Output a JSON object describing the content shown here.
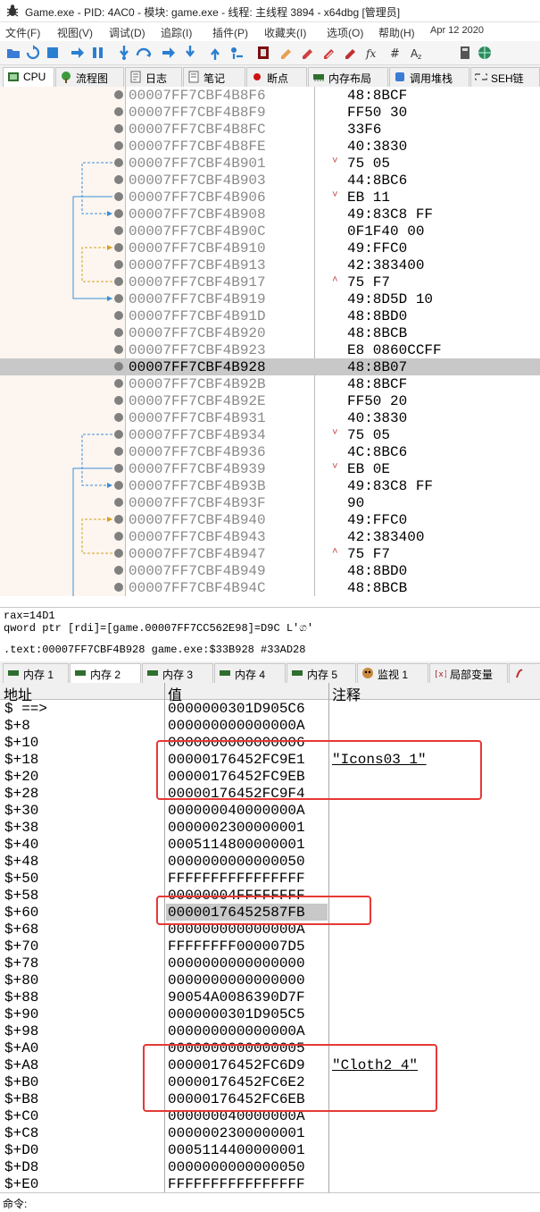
{
  "window": {
    "title": "Game.exe - PID: 4AC0 - 模块: game.exe - 线程: 主线程 3894 - x64dbg [管理员]"
  },
  "menu": {
    "items": [
      "文件(F)",
      "视图(V)",
      "调试(D)",
      "追踪(I)",
      "插件(P)",
      "收藏夹(I)",
      "选项(O)",
      "帮助(H)"
    ],
    "date": "Apr 12 2020"
  },
  "toolbar": {
    "icons": [
      "open-icon",
      "restart-icon",
      "stop-icon",
      "run-icon",
      "pause-icon",
      "step-into-icon",
      "step-over-icon",
      "trace-into-icon",
      "trace-over-icon",
      "execute-till-return-icon",
      "run-to-user-code-icon",
      "patch-icon",
      "comment-icon",
      "label-icon",
      "bookmark-icon",
      "function-icon",
      "fx-icon",
      "hash-icon",
      "font-icon",
      "calculator-icon",
      "globe-icon"
    ]
  },
  "cpu_tabs": [
    {
      "label": "CPU",
      "icon": "cpu-icon",
      "active": true
    },
    {
      "label": "流程图",
      "icon": "graph-icon"
    },
    {
      "label": "日志",
      "icon": "log-icon"
    },
    {
      "label": "笔记",
      "icon": "notes-icon"
    },
    {
      "label": "断点",
      "icon": "breakpoint-icon"
    },
    {
      "label": "内存布局",
      "icon": "memory-map-icon"
    },
    {
      "label": "调用堆栈",
      "icon": "call-stack-icon"
    },
    {
      "label": "SEH链",
      "icon": "seh-icon"
    }
  ],
  "disasm": {
    "selected_index": 16,
    "rows": [
      {
        "addr": "00007FF7CBF4B8F6",
        "bytes": "48:8BCF",
        "arrow": ""
      },
      {
        "addr": "00007FF7CBF4B8F9",
        "bytes": "FF50 30",
        "arrow": ""
      },
      {
        "addr": "00007FF7CBF4B8FC",
        "bytes": "33F6",
        "arrow": ""
      },
      {
        "addr": "00007FF7CBF4B8FE",
        "bytes": "40:3830",
        "arrow": ""
      },
      {
        "addr": "00007FF7CBF4B901",
        "bytes": "75 05",
        "arrow": "v"
      },
      {
        "addr": "00007FF7CBF4B903",
        "bytes": "44:8BC6",
        "arrow": ""
      },
      {
        "addr": "00007FF7CBF4B906",
        "bytes": "EB 11",
        "arrow": "v"
      },
      {
        "addr": "00007FF7CBF4B908",
        "bytes": "49:83C8 FF",
        "arrow": ""
      },
      {
        "addr": "00007FF7CBF4B90C",
        "bytes": "0F1F40 00",
        "arrow": ""
      },
      {
        "addr": "00007FF7CBF4B910",
        "bytes": "49:FFC0",
        "arrow": ""
      },
      {
        "addr": "00007FF7CBF4B913",
        "bytes": "42:383400",
        "arrow": ""
      },
      {
        "addr": "00007FF7CBF4B917",
        "bytes": "75 F7",
        "arrow": "^"
      },
      {
        "addr": "00007FF7CBF4B919",
        "bytes": "49:8D5D 10",
        "arrow": ""
      },
      {
        "addr": "00007FF7CBF4B91D",
        "bytes": "48:8BD0",
        "arrow": ""
      },
      {
        "addr": "00007FF7CBF4B920",
        "bytes": "48:8BCB",
        "arrow": ""
      },
      {
        "addr": "00007FF7CBF4B923",
        "bytes": "E8 0860CCFF",
        "arrow": ""
      },
      {
        "addr": "00007FF7CBF4B928",
        "bytes": "48:8B07",
        "arrow": ""
      },
      {
        "addr": "00007FF7CBF4B92B",
        "bytes": "48:8BCF",
        "arrow": ""
      },
      {
        "addr": "00007FF7CBF4B92E",
        "bytes": "FF50 20",
        "arrow": ""
      },
      {
        "addr": "00007FF7CBF4B931",
        "bytes": "40:3830",
        "arrow": ""
      },
      {
        "addr": "00007FF7CBF4B934",
        "bytes": "75 05",
        "arrow": "v"
      },
      {
        "addr": "00007FF7CBF4B936",
        "bytes": "4C:8BC6",
        "arrow": ""
      },
      {
        "addr": "00007FF7CBF4B939",
        "bytes": "EB 0E",
        "arrow": "v"
      },
      {
        "addr": "00007FF7CBF4B93B",
        "bytes": "49:83C8 FF",
        "arrow": ""
      },
      {
        "addr": "00007FF7CBF4B93F",
        "bytes": "90",
        "arrow": ""
      },
      {
        "addr": "00007FF7CBF4B940",
        "bytes": "49:FFC0",
        "arrow": ""
      },
      {
        "addr": "00007FF7CBF4B943",
        "bytes": "42:383400",
        "arrow": ""
      },
      {
        "addr": "00007FF7CBF4B947",
        "bytes": "75 F7",
        "arrow": "^"
      },
      {
        "addr": "00007FF7CBF4B949",
        "bytes": "48:8BD0",
        "arrow": ""
      },
      {
        "addr": "00007FF7CBF4B94C",
        "bytes": "48:8BCB",
        "arrow": ""
      }
    ]
  },
  "info": {
    "line1": "rax=14D1",
    "line2": "qword ptr [rdi]=[game.00007FF7CC562E98]=D9C L'ග'",
    "line3": ".text:00007FF7CBF4B928 game.exe:$33B928 #33AD28"
  },
  "dump_tabs": [
    {
      "label": "内存 1",
      "icon": "memory-icon"
    },
    {
      "label": "内存 2",
      "icon": "memory-icon",
      "active": true
    },
    {
      "label": "内存 3",
      "icon": "memory-icon"
    },
    {
      "label": "内存 4",
      "icon": "memory-icon"
    },
    {
      "label": "内存 5",
      "icon": "memory-icon"
    },
    {
      "label": "监视 1",
      "icon": "watch-icon"
    },
    {
      "label": "局部变量",
      "icon": "locals-icon"
    }
  ],
  "dump": {
    "headers": {
      "address": "地址",
      "value": "值",
      "comment": "注释"
    },
    "highlighted_index": 12,
    "rows": [
      {
        "a": "$ ==>",
        "v": "0000000301D905C6",
        "c": ""
      },
      {
        "a": "$+8",
        "v": "000000000000000A",
        "c": ""
      },
      {
        "a": "$+10",
        "v": "0000000000000006",
        "c": ""
      },
      {
        "a": "$+18",
        "v": "00000176452FC9E1",
        "c": "\"Icons03_1\""
      },
      {
        "a": "$+20",
        "v": "00000176452FC9EB",
        "c": ""
      },
      {
        "a": "$+28",
        "v": "00000176452FC9F4",
        "c": ""
      },
      {
        "a": "$+30",
        "v": "000000040000000A",
        "c": ""
      },
      {
        "a": "$+38",
        "v": "0000002300000001",
        "c": ""
      },
      {
        "a": "$+40",
        "v": "0005114800000001",
        "c": ""
      },
      {
        "a": "$+48",
        "v": "0000000000000050",
        "c": ""
      },
      {
        "a": "$+50",
        "v": "FFFFFFFFFFFFFFFF",
        "c": ""
      },
      {
        "a": "$+58",
        "v": "00000004FFFFFFFF",
        "c": ""
      },
      {
        "a": "$+60",
        "v": "00000176452587FB",
        "c": ""
      },
      {
        "a": "$+68",
        "v": "000000000000000A",
        "c": ""
      },
      {
        "a": "$+70",
        "v": "FFFFFFFF000007D5",
        "c": ""
      },
      {
        "a": "$+78",
        "v": "0000000000000000",
        "c": ""
      },
      {
        "a": "$+80",
        "v": "0000000000000000",
        "c": ""
      },
      {
        "a": "$+88",
        "v": "90054A0086390D7F",
        "c": ""
      },
      {
        "a": "$+90",
        "v": "0000000301D905C5",
        "c": ""
      },
      {
        "a": "$+98",
        "v": "000000000000000A",
        "c": ""
      },
      {
        "a": "$+A0",
        "v": "0000000000000005",
        "c": ""
      },
      {
        "a": "$+A8",
        "v": "00000176452FC6D9",
        "c": "\"Cloth2_4\""
      },
      {
        "a": "$+B0",
        "v": "00000176452FC6E2",
        "c": ""
      },
      {
        "a": "$+B8",
        "v": "00000176452FC6EB",
        "c": ""
      },
      {
        "a": "$+C0",
        "v": "000000040000000A",
        "c": ""
      },
      {
        "a": "$+C8",
        "v": "0000002300000001",
        "c": ""
      },
      {
        "a": "$+D0",
        "v": "0005114400000001",
        "c": ""
      },
      {
        "a": "$+D8",
        "v": "0000000000000050",
        "c": ""
      },
      {
        "a": "$+E0",
        "v": "FFFFFFFFFFFFFFFF",
        "c": ""
      }
    ]
  },
  "command": {
    "label": "命令:"
  },
  "colors": {
    "accent": "#e53935",
    "selection": "#c8c8c8",
    "branch_blue": "#3a8fd6",
    "branch_orange": "#d4a020"
  }
}
